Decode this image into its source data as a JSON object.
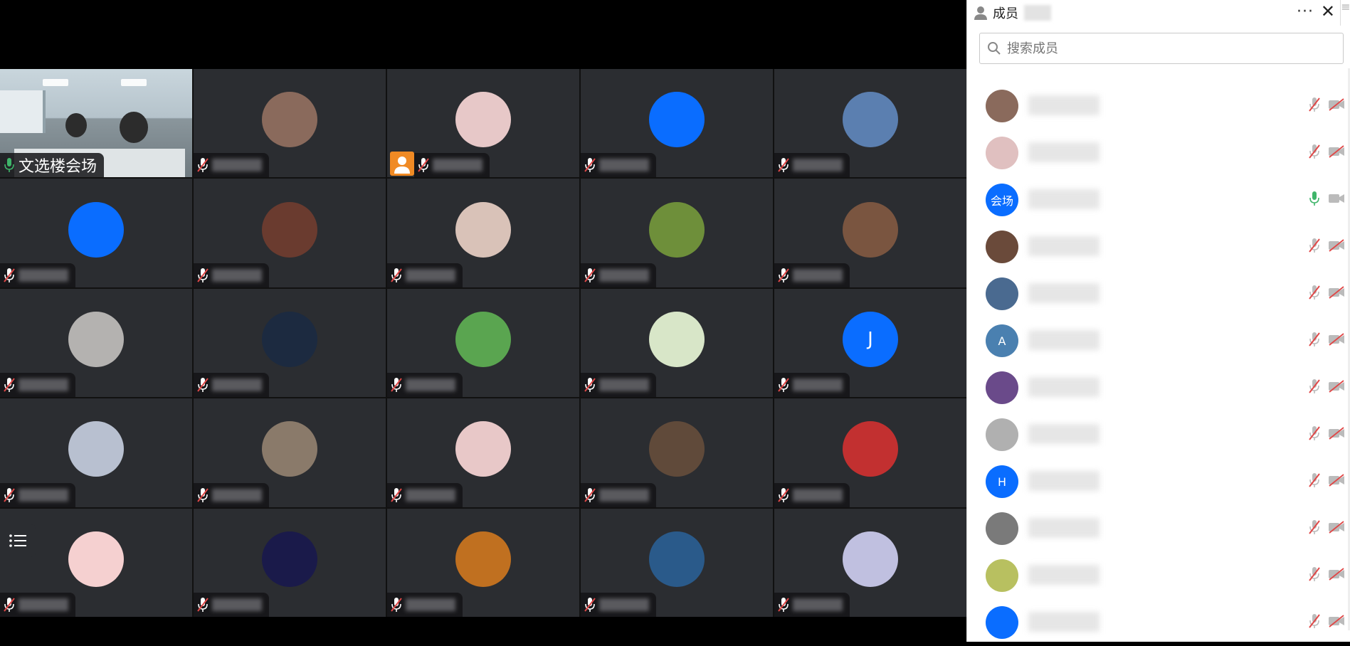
{
  "featured_tile": {
    "name": "文选楼会场"
  },
  "panel": {
    "title": "成员",
    "more_label": "···",
    "close_label": "✕",
    "search_placeholder": "搜索成员"
  },
  "avatars": [
    {
      "initial": "J",
      "row": 3,
      "col": 5
    }
  ],
  "members": [
    {
      "initial": "",
      "mic": "muted",
      "cam": "off"
    },
    {
      "initial": "",
      "mic": "muted",
      "cam": "off"
    },
    {
      "initial": "会场",
      "mic": "on",
      "cam": "on"
    },
    {
      "initial": "",
      "mic": "muted",
      "cam": "off"
    },
    {
      "initial": "",
      "mic": "muted",
      "cam": "off"
    },
    {
      "initial": "A",
      "mic": "muted",
      "cam": "off"
    },
    {
      "initial": "",
      "mic": "muted",
      "cam": "off"
    },
    {
      "initial": "",
      "mic": "muted",
      "cam": "off"
    },
    {
      "initial": "H",
      "mic": "muted",
      "cam": "off"
    },
    {
      "initial": "",
      "mic": "muted",
      "cam": "off"
    },
    {
      "initial": "",
      "mic": "muted",
      "cam": "off"
    },
    {
      "initial": "",
      "mic": "muted",
      "cam": "off"
    }
  ],
  "colors": {
    "accent_blue": "#0a6dff",
    "tile_bg": "#2b2d31",
    "mic_on": "#3fb56a",
    "muted_red": "#e04848"
  }
}
